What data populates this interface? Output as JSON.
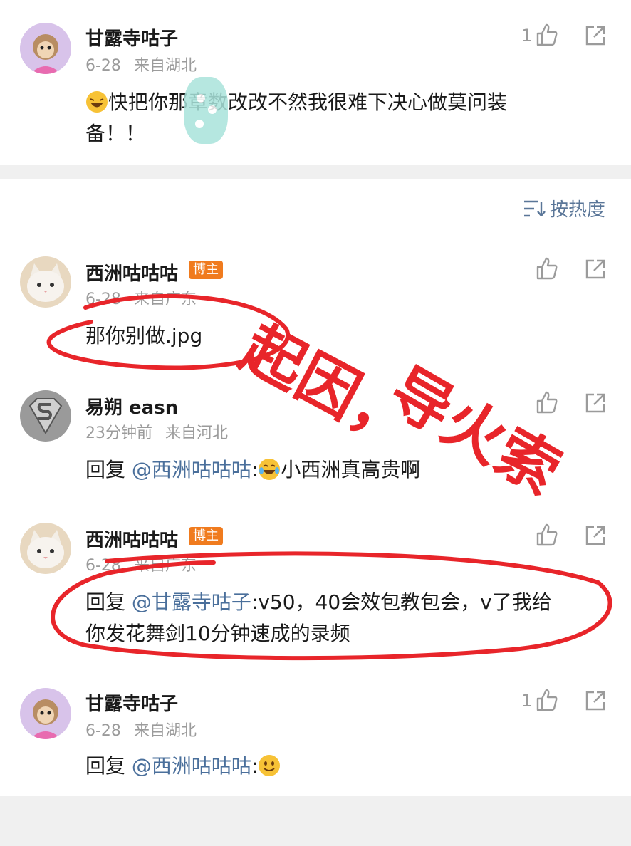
{
  "top_comment": {
    "user": "甘露寺咕子",
    "date": "6-28",
    "location": "来自湖北",
    "likes": "1",
    "text_a": "快把你那",
    "text_b": "章数改改不然我很难下决心做莫问装",
    "text_line2": "备！！"
  },
  "sort": {
    "label": "按热度"
  },
  "comments": [
    {
      "user": "西洲咕咕咕",
      "badge": "博主",
      "date": "6-28",
      "location": "来自广东",
      "text": "那你别做.jpg"
    },
    {
      "user": "易朔 easn",
      "date": "23分钟前",
      "location": "来自河北",
      "reply_prefix": "回复 ",
      "mention": "@西洲咕咕咕",
      "text": ":",
      "text_after": "小西洲真高贵啊"
    },
    {
      "user": "西洲咕咕咕",
      "badge": "博主",
      "date": "6-28",
      "location": "来自广东",
      "reply_prefix": "回复 ",
      "mention": "@甘露寺咕子",
      "text": ":v50，40会效包教包会，v了我给",
      "text_line2": "你发花舞剑10分钟速成的录频"
    },
    {
      "user": "甘露寺咕子",
      "date": "6-28",
      "location": "来自湖北",
      "likes": "1",
      "reply_prefix": "回复 ",
      "mention": "@西洲咕咕咕",
      "text": ":"
    }
  ],
  "annotation": {
    "line1": "起因，",
    "line2": "导火索"
  },
  "colors": {
    "annotation_red": "#e8252a",
    "mention_blue": "#4a6f9b",
    "badge_orange": "#f07b1e",
    "meta_gray": "#9b9b9b"
  }
}
